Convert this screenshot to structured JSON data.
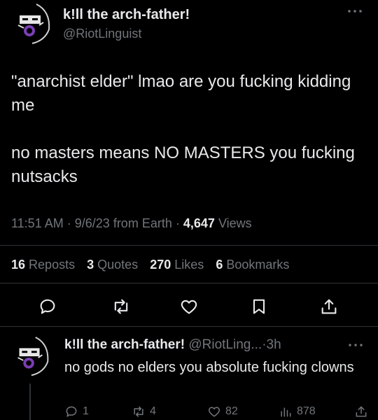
{
  "tweet": {
    "author": {
      "display_name": "k!ll the arch-father!",
      "handle": "@RiotLinguist"
    },
    "paragraphs": [
      "\"anarchist elder\" lmao are you fucking kidding me",
      "no masters means NO MASTERS you fucking nutsacks"
    ],
    "time": "11:51 AM",
    "date": "9/6/23",
    "source": "from Earth",
    "separator": "·",
    "views_count": "4,647",
    "views_label": "Views"
  },
  "stats": {
    "reposts_count": "16",
    "reposts_label": "Reposts",
    "quotes_count": "3",
    "quotes_label": "Quotes",
    "likes_count": "270",
    "likes_label": "Likes",
    "bookmarks_count": "6",
    "bookmarks_label": "Bookmarks"
  },
  "actions": [
    "reply-icon",
    "repost-icon",
    "like-icon",
    "bookmark-icon",
    "share-icon"
  ],
  "reply": {
    "display_name": "k!ll the arch-father!",
    "handle": "@RiotLing...",
    "separator": "·",
    "time_ago": "3h",
    "text": "no gods no elders you absolute fucking clowns",
    "reply_count": "1",
    "repost_count": "4",
    "like_count": "82",
    "views_count": "878"
  },
  "colors": {
    "background": "#000000",
    "text_primary": "#e7e9ea",
    "text_secondary": "#71767b",
    "divider": "#2f3336",
    "avatar_accent": "#7b3fb5"
  }
}
